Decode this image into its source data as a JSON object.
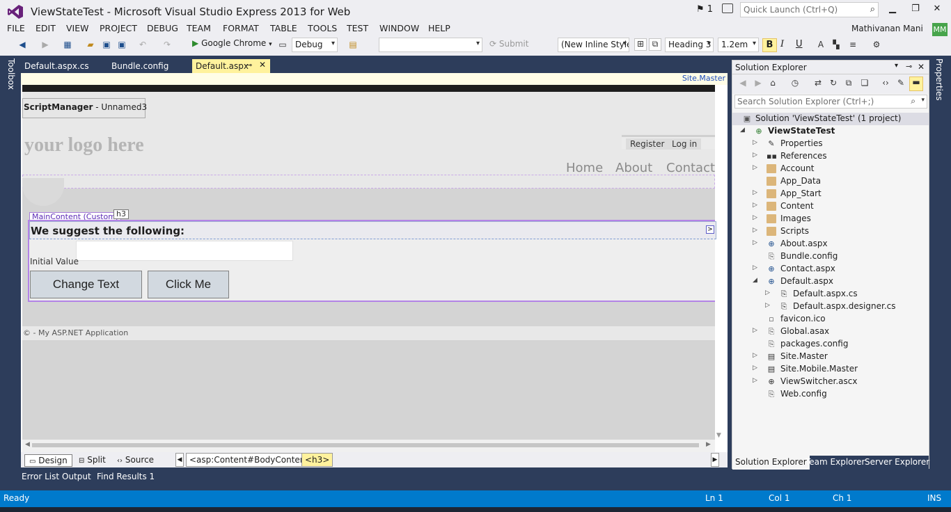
{
  "window": {
    "title": "ViewStateTest - Microsoft Visual Studio Express 2013 for Web",
    "notifications_count": "1",
    "quick_launch_placeholder": "Quick Launch (Ctrl+Q)"
  },
  "menu": {
    "items": [
      "FILE",
      "EDIT",
      "VIEW",
      "PROJECT",
      "DEBUG",
      "TEAM",
      "FORMAT",
      "TABLE",
      "TOOLS",
      "TEST",
      "WINDOW",
      "HELP"
    ],
    "user": "Mathivanan Mani",
    "avatar_initials": "MM"
  },
  "toolbar": {
    "browser": "Google Chrome",
    "config": "Debug",
    "target": "",
    "submit": "Submit",
    "style": "(New Inline Style",
    "block_format": "Heading 3",
    "font_size": "1.2em",
    "bold": "B",
    "italic": "I",
    "underline": "U"
  },
  "side": {
    "toolbox": "Toolbox",
    "properties": "Properties"
  },
  "tabs": [
    {
      "label": "Default.aspx.cs"
    },
    {
      "label": "Bundle.config"
    },
    {
      "label": "Default.aspx",
      "active": true
    }
  ],
  "designer": {
    "master_link": "Site.Master",
    "script_manager_bold": "ScriptManager",
    "script_manager_rest": " - Unnamed3",
    "logo_text": "your logo here",
    "register": "Register",
    "login": "Log in",
    "nav": [
      "Home",
      "About",
      "Contact"
    ],
    "content_tag": "MainContent (Custom)",
    "h3_tag": "h3",
    "heading": "We suggest the following:",
    "expander": ">",
    "initial_value_label": "Initial Value",
    "change_text_button": "Change Text",
    "click_me_button": "Click Me",
    "footer": "© - My ASP.NET Application"
  },
  "view_modes": {
    "design": "Design",
    "split": "Split",
    "source": "Source",
    "crumb_content": "<asp:Content#BodyContent>",
    "crumb_h3": "<h3>"
  },
  "output_tabs": [
    "Error List",
    "Output",
    "Find Results 1"
  ],
  "solution_explorer": {
    "title": "Solution Explorer",
    "search_placeholder": "Search Solution Explorer (Ctrl+;)",
    "nodes": [
      {
        "label": "Solution 'ViewStateTest' (1 project)",
        "icon": "solution-icon"
      },
      {
        "label": "ViewStateTest",
        "icon": "web-project-icon"
      },
      {
        "label": "Properties",
        "icon": "wrench-icon"
      },
      {
        "label": "References",
        "icon": "references-icon"
      },
      {
        "label": "Account",
        "icon": "folder-icon"
      },
      {
        "label": "App_Data",
        "icon": "folder-icon"
      },
      {
        "label": "App_Start",
        "icon": "folder-icon"
      },
      {
        "label": "Content",
        "icon": "folder-icon"
      },
      {
        "label": "Images",
        "icon": "folder-icon"
      },
      {
        "label": "Scripts",
        "icon": "folder-icon"
      },
      {
        "label": "About.aspx",
        "icon": "aspx-file-icon"
      },
      {
        "label": "Bundle.config",
        "icon": "config-file-icon"
      },
      {
        "label": "Contact.aspx",
        "icon": "aspx-file-icon"
      },
      {
        "label": "Default.aspx",
        "icon": "aspx-file-icon"
      },
      {
        "label": "Default.aspx.cs",
        "icon": "cs-file-icon"
      },
      {
        "label": "Default.aspx.designer.cs",
        "icon": "cs-file-icon"
      },
      {
        "label": "favicon.ico",
        "icon": "image-file-icon"
      },
      {
        "label": "Global.asax",
        "icon": "asax-file-icon"
      },
      {
        "label": "packages.config",
        "icon": "config-file-icon"
      },
      {
        "label": "Site.Master",
        "icon": "master-file-icon"
      },
      {
        "label": "Site.Mobile.Master",
        "icon": "master-file-icon"
      },
      {
        "label": "ViewSwitcher.ascx",
        "icon": "ascx-file-icon"
      },
      {
        "label": "Web.config",
        "icon": "config-file-icon"
      }
    ],
    "bottom_tabs": [
      "Solution Explorer",
      "Team Explorer",
      "Server Explorer"
    ]
  },
  "status": {
    "state": "Ready",
    "line": "Ln 1",
    "col": "Col 1",
    "ch": "Ch 1",
    "mode": "INS"
  },
  "colors": {
    "accent": "#007acc",
    "chrome": "#eeeef2",
    "frame": "#2d3d5b",
    "active_tab": "#fff29d"
  }
}
